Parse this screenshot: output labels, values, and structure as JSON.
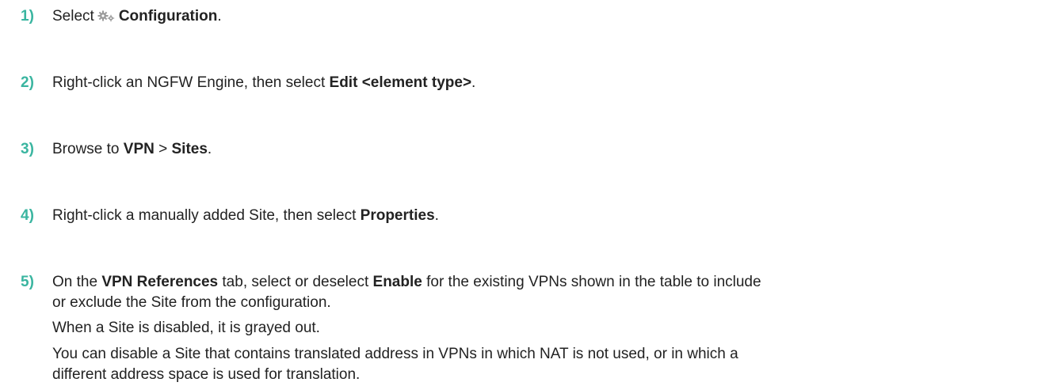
{
  "steps": [
    {
      "number": "1)",
      "pre": "Select",
      "icon": "configuration-gear-icon",
      "bold": "Configuration",
      "post": "."
    },
    {
      "number": "2)",
      "pre": "Right-click an NGFW Engine, then select ",
      "bold": "Edit <element type>",
      "post": "."
    },
    {
      "number": "3)",
      "pre": "Browse to ",
      "bold1": "VPN",
      "mid": " > ",
      "bold2": "Sites",
      "post": "."
    },
    {
      "number": "4)",
      "pre": "Right-click a manually added Site, then select ",
      "bold": "Properties",
      "post": "."
    },
    {
      "number": "5)",
      "pre": "On the ",
      "bold1": "VPN References",
      "mid": " tab, select or deselect ",
      "bold2": "Enable",
      "post": " for the existing VPNs shown in the table to include",
      "line2": "or exclude the Site from the configuration.",
      "note1": "When a Site is disabled, it is grayed out.",
      "note2_line1": "You can disable a Site that contains translated address in VPNs in which NAT is not used, or in which a",
      "note2_line2": "different address space is used for translation."
    }
  ],
  "colors": {
    "step_number": "#3ab5a0",
    "text": "#222222",
    "icon": "#9a9a9a"
  }
}
